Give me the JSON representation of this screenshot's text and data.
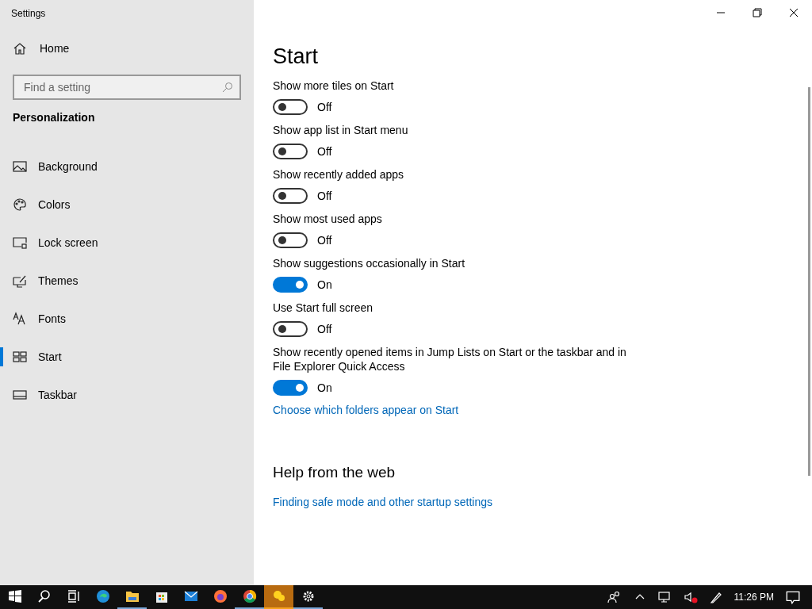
{
  "window": {
    "title": "Settings"
  },
  "sidebar": {
    "home": "Home",
    "search": {
      "placeholder": "Find a setting"
    },
    "section": "Personalization",
    "items": [
      {
        "kind": "background",
        "label": "Background",
        "selected": false
      },
      {
        "kind": "colors",
        "label": "Colors",
        "selected": false
      },
      {
        "kind": "lock",
        "label": "Lock screen",
        "selected": false
      },
      {
        "kind": "themes",
        "label": "Themes",
        "selected": false
      },
      {
        "kind": "fonts",
        "label": "Fonts",
        "selected": false
      },
      {
        "kind": "start",
        "label": "Start",
        "selected": true
      },
      {
        "kind": "taskbar",
        "label": "Taskbar",
        "selected": false
      }
    ]
  },
  "content": {
    "title": "Start",
    "settings": [
      {
        "label": "Show more tiles on Start",
        "on": false,
        "state": "Off"
      },
      {
        "label": "Show app list in Start menu",
        "on": false,
        "state": "Off"
      },
      {
        "label": "Show recently added apps",
        "on": false,
        "state": "Off"
      },
      {
        "label": "Show most used apps",
        "on": false,
        "state": "Off"
      },
      {
        "label": "Show suggestions occasionally in Start",
        "on": true,
        "state": "On"
      },
      {
        "label": "Use Start full screen",
        "on": false,
        "state": "Off"
      },
      {
        "label": "Show recently opened items in Jump Lists on Start or the taskbar and in File Explorer Quick Access",
        "on": true,
        "state": "On"
      }
    ],
    "link": "Choose which folders appear on Start",
    "help": {
      "title": "Help from the web",
      "links": [
        "Finding safe mode and other startup settings"
      ]
    }
  },
  "taskbar": {
    "apps": [
      {
        "kind": "start",
        "running": false,
        "selected": false
      },
      {
        "kind": "search",
        "running": false,
        "selected": false
      },
      {
        "kind": "taskview",
        "running": false,
        "selected": false
      },
      {
        "kind": "edge",
        "running": false,
        "selected": false
      },
      {
        "kind": "folder",
        "running": true,
        "selected": false
      },
      {
        "kind": "store",
        "running": false,
        "selected": false
      },
      {
        "kind": "mail",
        "running": false,
        "selected": false
      },
      {
        "kind": "firefox",
        "running": false,
        "selected": false
      },
      {
        "kind": "chrome",
        "running": true,
        "selected": false
      },
      {
        "kind": "blob",
        "running": true,
        "selected": true
      },
      {
        "kind": "gear",
        "running": true,
        "selected": false
      }
    ],
    "time": "11:26 PM"
  }
}
